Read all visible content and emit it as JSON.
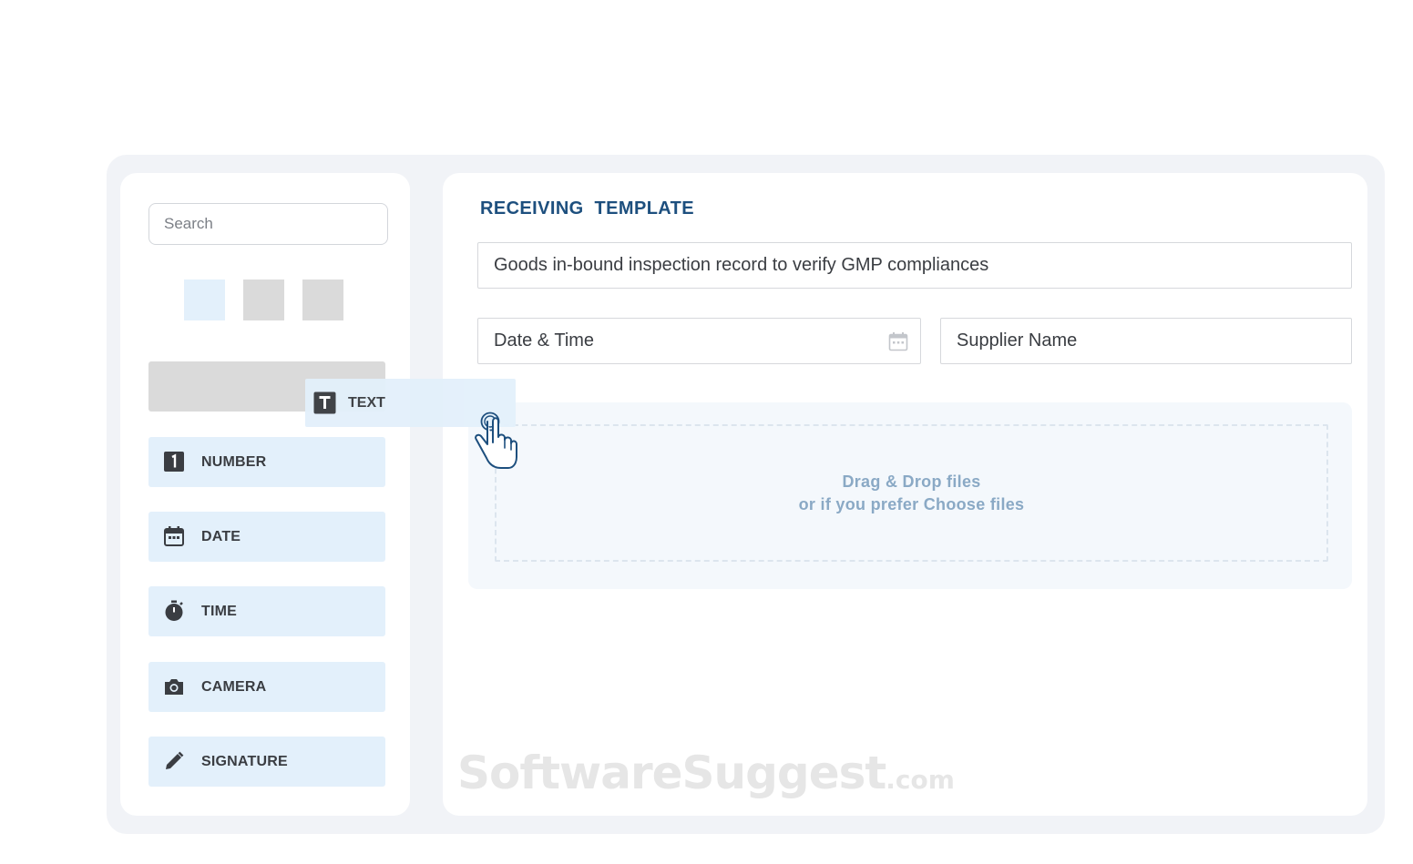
{
  "sidebar": {
    "search_placeholder": "Search",
    "dragging_item": {
      "label": "TEXT",
      "icon": "text-field-icon"
    },
    "field_types": [
      {
        "label": "NUMBER",
        "icon": "number-icon"
      },
      {
        "label": "DATE",
        "icon": "calendar-icon"
      },
      {
        "label": "TIME",
        "icon": "stopwatch-icon"
      },
      {
        "label": "CAMERA",
        "icon": "camera-icon"
      },
      {
        "label": "SIGNATURE",
        "icon": "pencil-icon"
      }
    ]
  },
  "template": {
    "title": "RECEIVING  TEMPLATE",
    "description": "Goods in-bound inspection record to verify GMP compliances",
    "date_time_label": "Date & Time",
    "supplier_label": "Supplier Name",
    "dropzone": {
      "line1": "Drag & Drop files",
      "line2": "or if you prefer Choose files"
    }
  },
  "watermark": {
    "main": "SoftwareSuggest",
    "suffix": ".com"
  },
  "colors": {
    "title": "#1d4f7e",
    "field_bg": "#e3f0fb",
    "drop_text": "#8aa9c5",
    "icon": "#3a3d42"
  }
}
